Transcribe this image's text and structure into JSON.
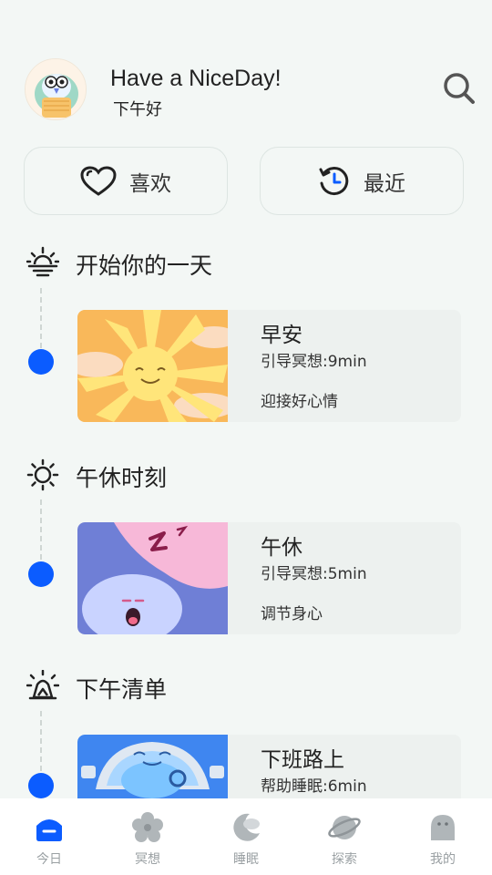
{
  "header": {
    "greeting": "Have a NiceDay!",
    "subtitle": "下午好"
  },
  "quick": {
    "like_label": "喜欢",
    "recent_label": "最近"
  },
  "sections": [
    {
      "title": "开始你的一天",
      "card": {
        "title": "早安",
        "meta": "引导冥想:9min",
        "desc": "迎接好心情"
      }
    },
    {
      "title": "午休时刻",
      "card": {
        "title": "午休",
        "meta": "引导冥想:5min",
        "desc": "调节身心"
      }
    },
    {
      "title": "下午清单",
      "card": {
        "title": "下班路上",
        "meta": "帮助睡眠:6min",
        "desc": ""
      }
    }
  ],
  "tabs": [
    {
      "label": "今日",
      "icon": "today-icon",
      "active": true
    },
    {
      "label": "冥想",
      "icon": "flower-icon",
      "active": false
    },
    {
      "label": "睡眠",
      "icon": "moon-icon",
      "active": false
    },
    {
      "label": "探索",
      "icon": "planet-icon",
      "active": false
    },
    {
      "label": "我的",
      "icon": "ghost-icon",
      "active": false
    }
  ],
  "colors": {
    "accent": "#0b5cff",
    "background": "#f3f7f5",
    "card": "#edf1ef",
    "tab_inactive": "#b0b6b9"
  }
}
